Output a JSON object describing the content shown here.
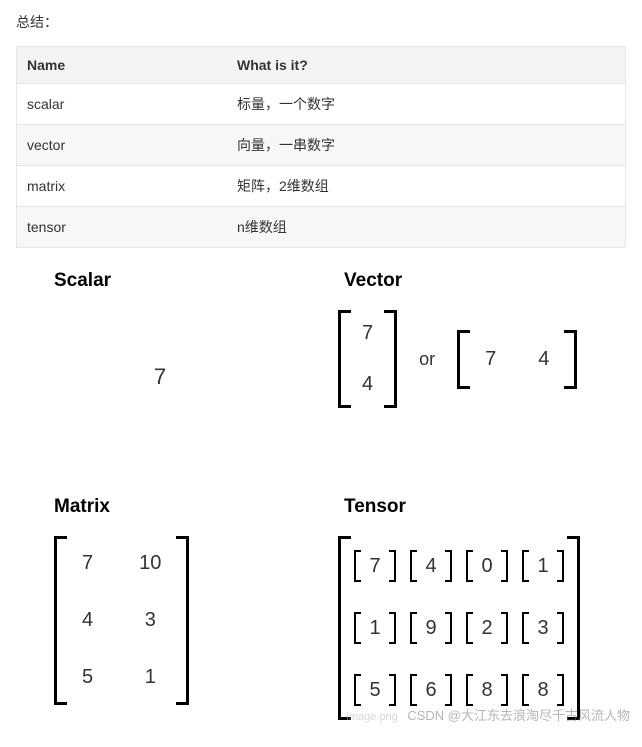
{
  "summary": "总结：",
  "table": {
    "headers": [
      "Name",
      "What is it?"
    ],
    "rows": [
      {
        "name": "scalar",
        "desc": "标量，一个数字"
      },
      {
        "name": "vector",
        "desc": "向量，一串数字"
      },
      {
        "name": "matrix",
        "desc": "矩阵，2维数组"
      },
      {
        "name": "tensor",
        "desc": "n维数组"
      }
    ]
  },
  "diagram": {
    "scalar": {
      "title": "Scalar",
      "value": "7"
    },
    "vector": {
      "title": "Vector",
      "col": [
        "7",
        "4"
      ],
      "or_label": "or",
      "row": [
        "7",
        "4"
      ]
    },
    "matrix": {
      "title": "Matrix",
      "values": [
        [
          "7",
          "10"
        ],
        [
          "4",
          "3"
        ],
        [
          "5",
          "1"
        ]
      ]
    },
    "tensor": {
      "title": "Tensor",
      "values": [
        [
          "7",
          "4",
          "0",
          "1"
        ],
        [
          "1",
          "9",
          "2",
          "3"
        ],
        [
          "5",
          "6",
          "8",
          "8"
        ]
      ]
    }
  },
  "watermark": {
    "prefix": "image.png",
    "text": "CSDN @大江东去浪淘尽千古风流人物"
  }
}
